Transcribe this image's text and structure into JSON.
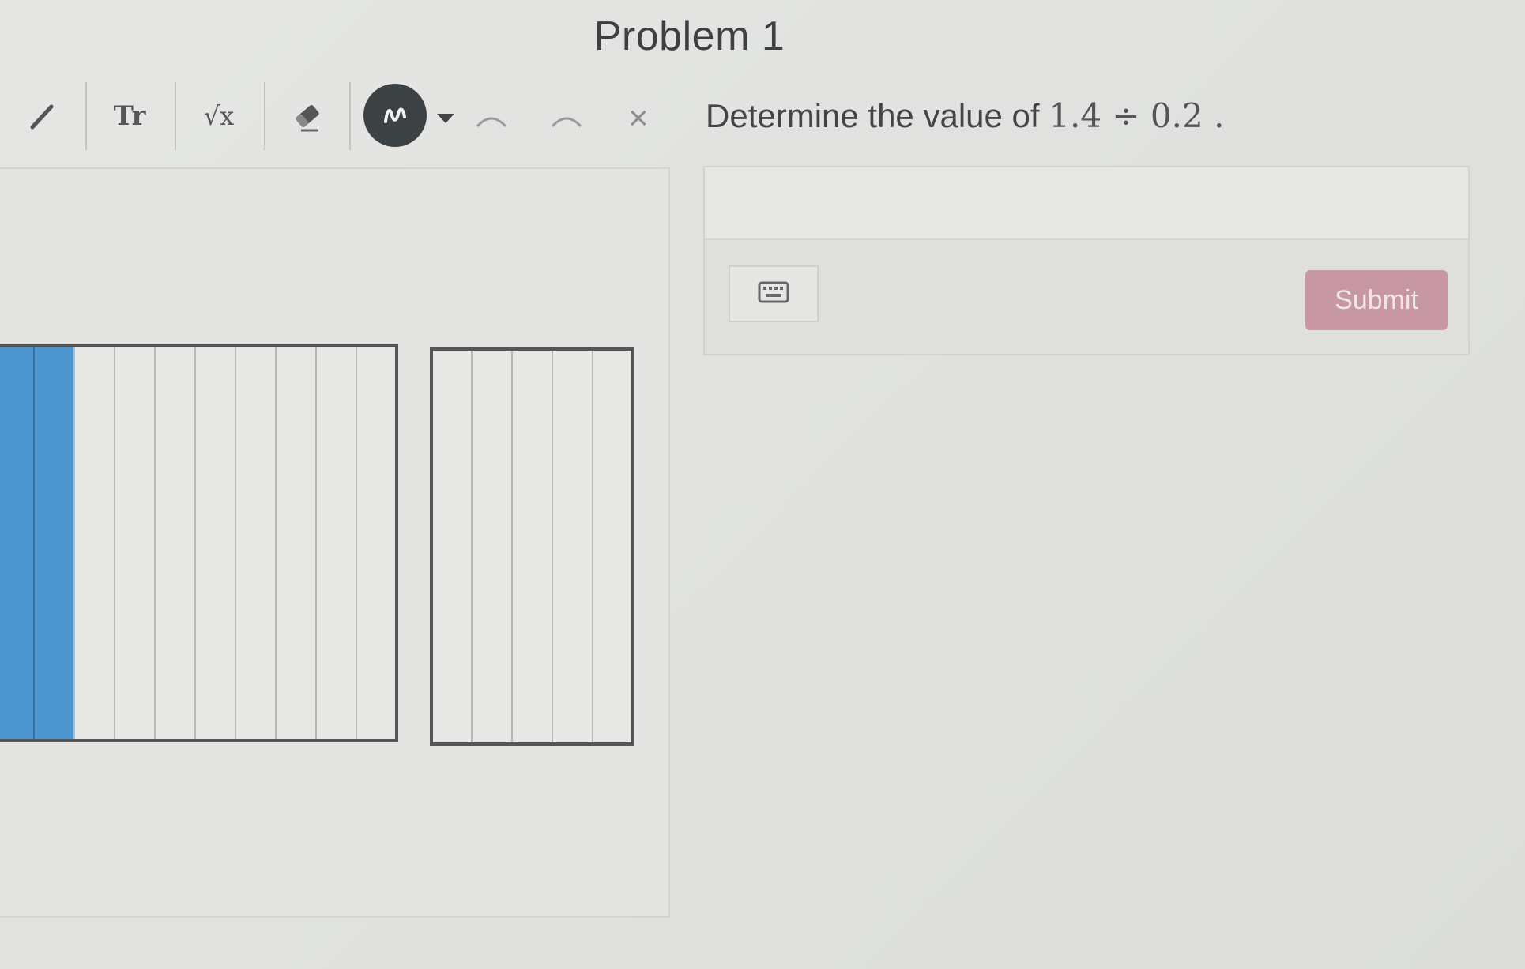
{
  "problem": {
    "title": "Problem 1",
    "question_prefix": "Determine the value of",
    "question_math": "1.4 ÷ 0.2 ."
  },
  "toolbar": {
    "tools": [
      {
        "name": "pencil-icon"
      },
      {
        "name": "text-tool-icon",
        "glyph": "Tr"
      },
      {
        "name": "math-tool-icon",
        "glyph": "√x"
      },
      {
        "name": "eraser-icon"
      }
    ],
    "color_picker": {
      "icon": "squiggle-icon",
      "color": "#3c4244"
    },
    "undo_icon": "undo-icon",
    "redo_icon": "redo-icon",
    "clear_icon": "close-icon",
    "clear_glyph": "×"
  },
  "canvas": {
    "model_large": {
      "columns": 10,
      "shaded_columns": 2,
      "shade_color": "#4d95cf"
    },
    "model_small": {
      "columns": 5,
      "shaded_columns": 0
    }
  },
  "answer": {
    "input_value": "",
    "keyboard_icon": "keyboard-icon",
    "submit_label": "Submit",
    "submit_color": "#c897a4"
  }
}
